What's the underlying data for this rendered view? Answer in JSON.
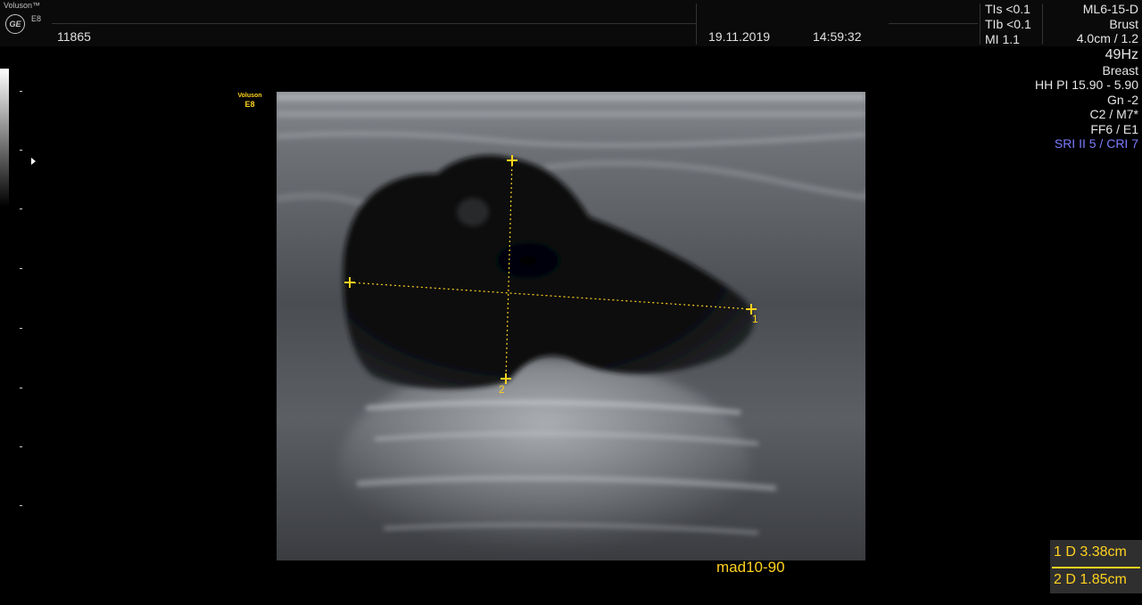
{
  "header": {
    "brand": "Voluson™",
    "logo_mark": "GE",
    "model": "E8",
    "patient_id": "11865",
    "date": "19.11.2019",
    "time": "14:59:32"
  },
  "safety": {
    "tis": "TIs <0.1",
    "tib": "TIb <0.1",
    "mi": "MI  1.1"
  },
  "params": {
    "probe": "ML6-15-D",
    "program": "Brust",
    "depth": "4.0cm / 1.2",
    "frame_rate": "49Hz",
    "application": "Breast",
    "harmonic": "HH PI 15.90 - 5.90",
    "gain": "Gn  -2",
    "map": "C2 / M7*",
    "filter": "FF6 / E1",
    "processing": "SRI II 5 / CRI 7"
  },
  "image_brand": {
    "name": "Voluson",
    "model": "E8"
  },
  "measurements": {
    "marker_1": "1",
    "marker_2": "2",
    "rows": [
      "1 D 3.38cm",
      "2 D 1.85cm"
    ]
  },
  "preset": "mad10-90",
  "colors": {
    "caliper": "#ffd21f",
    "accent": "#7b7bff",
    "background": "#000000"
  },
  "icons": [
    "ge-logo-icon",
    "focus-marker-icon"
  ]
}
